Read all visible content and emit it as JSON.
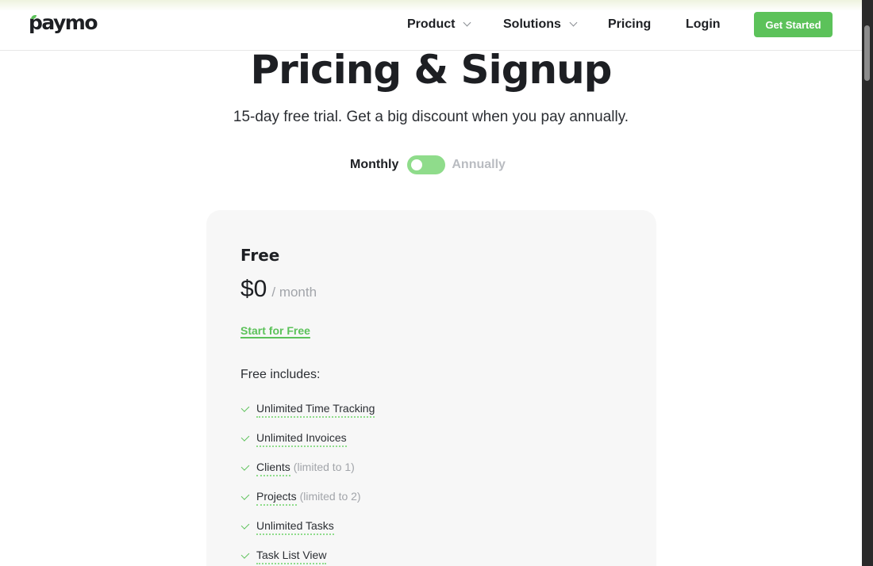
{
  "header": {
    "logo_text": "paymo",
    "nav": [
      {
        "label": "Product",
        "has_dropdown": true
      },
      {
        "label": "Solutions",
        "has_dropdown": true
      },
      {
        "label": "Pricing",
        "has_dropdown": false
      },
      {
        "label": "Login",
        "has_dropdown": false
      }
    ],
    "cta_label": "Get Started"
  },
  "hero": {
    "title": "Pricing & Signup",
    "subtitle": "15-day free trial. Get a big discount when you pay annually."
  },
  "billing_toggle": {
    "left_label": "Monthly",
    "right_label": "Annually",
    "selected": "Monthly"
  },
  "plan": {
    "name": "Free",
    "price": "$0",
    "period": "/ month",
    "cta_label": "Start for Free",
    "includes_heading": "Free includes:",
    "features": [
      {
        "label": "Unlimited Time Tracking",
        "note": ""
      },
      {
        "label": "Unlimited Invoices",
        "note": ""
      },
      {
        "label": "Clients",
        "note": "(limited to 1)"
      },
      {
        "label": "Projects",
        "note": "(limited to 2)"
      },
      {
        "label": "Unlimited Tasks",
        "note": ""
      },
      {
        "label": "Task List View",
        "note": ""
      }
    ]
  },
  "colors": {
    "brand_green": "#5cc25a",
    "toggle_green": "#8fdc8b",
    "text_dark": "#1d1f23",
    "muted": "#a2a5aa",
    "card_bg": "#f7f7f7"
  }
}
